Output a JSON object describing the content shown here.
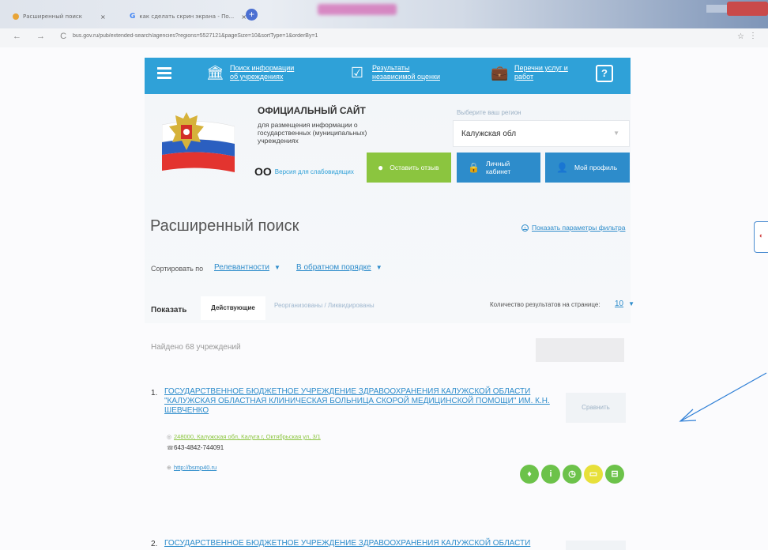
{
  "browser": {
    "tab1_title": "Расширенный поиск",
    "tab2_title": "как сделать скрин экрана - По...",
    "new_tab": "+",
    "address": "bus.gov.ru/pub/extended-search/agencies?regions=5527121&pageSize=10&sortType=1&orderBy=1",
    "nav_glyphs": "← → C",
    "star": "☆",
    "kebab": "⋮"
  },
  "sitenav": {
    "item1": "Поиск информации об учреждениях",
    "item2": "Результаты независимой оценки",
    "item3": "Перечни услуг и работ",
    "help": "?"
  },
  "header": {
    "title": "ОФИЦИАЛЬНЫЙ САЙТ",
    "subtitle": "для размещения информации о государственных (муниципальных) учреждениях",
    "low_vision": "Версия для слабовидящих",
    "region_label": "Выберите ваш регион",
    "region_value": "Калужская обл",
    "btn_feedback": "Оставить отзыв",
    "btn_cabinet": "Личный кабинет",
    "btn_profile": "Мой профиль"
  },
  "search": {
    "title": "Расширенный поиск",
    "filter_link": "Показать параметры фильтра",
    "sort_label": "Сортировать по",
    "sort_field": "Релевантности",
    "sort_order": "В обратном порядке",
    "show_label": "Показать",
    "tab_active": "Действующие",
    "tab_inactive": "Реорганизованы / Ликвидированы",
    "per_page_label": "Количество результатов на странице:",
    "per_page_value": "10"
  },
  "results": {
    "found": "Найдено 68 учреждений",
    "compare_label": "Сравнить",
    "items": [
      {
        "num": "1.",
        "title": "ГОСУДАРСТВЕННОЕ БЮДЖЕТНОЕ УЧРЕЖДЕНИЕ ЗДРАВООХРАНЕНИЯ КАЛУЖСКОЙ ОБЛАСТИ \"КАЛУЖСКАЯ ОБЛАСТНАЯ КЛИНИЧЕСКАЯ БОЛЬНИЦА СКОРОЙ МЕДИЦИНСКОЙ ПОМОЩИ\" ИМ. К.Н. ШЕВЧЕНКО",
        "address": "248000, Калужская обл, Калуга г, Октябрьская ул, 3/1",
        "phone": "643-4842-744091",
        "site": "http://bsmp40.ru"
      },
      {
        "num": "2.",
        "title": "ГОСУДАРСТВЕННОЕ БЮДЖЕТНОЕ УЧРЕЖДЕНИЕ ЗДРАВООХРАНЕНИЯ КАЛУЖСКОЙ ОБЛАСТИ"
      }
    ]
  },
  "colors": {
    "primary_blue": "#2fa1d8",
    "link_blue": "#2d8ccb",
    "green": "#8bc53f"
  }
}
